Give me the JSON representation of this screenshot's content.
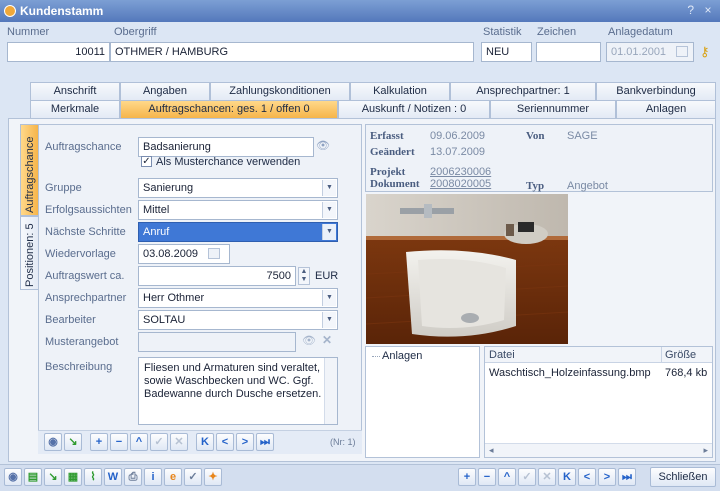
{
  "window": {
    "title": "Kundenstamm",
    "help": "?",
    "close": "×"
  },
  "header": {
    "nummer_label": "Nummer",
    "nummer_value": "10011",
    "obergriff_label": "Obergriff",
    "obergriff_value": "OTHMER / HAMBURG",
    "statistik_label": "Statistik",
    "statistik_value": "NEU",
    "zeichen_label": "Zeichen",
    "zeichen_value": "",
    "anlagedatum_label": "Anlagedatum",
    "anlagedatum_value": "01.01.2001"
  },
  "tabs_row1": [
    "Anschrift",
    "Angaben",
    "Zahlungskonditionen",
    "Kalkulation",
    "Ansprechpartner: 1",
    "Bankverbindung"
  ],
  "tabs_row2": [
    "Merkmale",
    "Auftragschancen: ges. 1 / offen 0",
    "Auskunft / Notizen : 0",
    "Seriennummer",
    "Anlagen"
  ],
  "side_tabs": [
    "Auftragschance",
    "Positionen: 5"
  ],
  "form": {
    "auftragschance_label": "Auftragschance",
    "auftragschance_value": "Badsanierung",
    "muster_checkbox_label": "Als Musterchance verwenden",
    "gruppe_label": "Gruppe",
    "gruppe_value": "Sanierung",
    "erfolg_label": "Erfolgsaussichten",
    "erfolg_value": "Mittel",
    "naechste_label": "Nächste Schritte",
    "naechste_value": "Anruf",
    "wiedervorlage_label": "Wiedervorlage",
    "wiedervorlage_value": "03.08.2009",
    "auftragswert_label": "Auftragswert ca.",
    "auftragswert_value": "7500",
    "currency": "EUR",
    "ansprechpartner_label": "Ansprechpartner",
    "ansprechpartner_value": "Herr Othmer",
    "bearbeiter_label": "Bearbeiter",
    "bearbeiter_value": "SOLTAU",
    "musterangebot_label": "Musterangebot",
    "musterangebot_value": "",
    "beschreibung_label": "Beschreibung",
    "beschreibung_value": "Fliesen und Armaturen sind veraltet, sowie Waschbecken und WC. Ggf. Badewanne durch Dusche ersetzen."
  },
  "info": {
    "erfasst_label": "Erfasst",
    "erfasst_value": "09.06.2009",
    "von_label": "Von",
    "von_value": "SAGE",
    "geaendert_label": "Geändert",
    "geaendert_value": "13.07.2009",
    "projekt_label": "Projekt",
    "projekt_value": "2006230006",
    "dokument_label": "Dokument",
    "dokument_value": "2008020005",
    "typ_label": "Typ",
    "typ_value": "Angebot"
  },
  "attachments": {
    "tree_root": "Anlagen",
    "col_datei": "Datei",
    "col_groesse": "Größe",
    "rows": [
      {
        "datei": "Waschtisch_Holzeinfassung.bmp",
        "groesse": "768,4 kb"
      }
    ]
  },
  "nav": {
    "record_counter": "(Nr: 1)"
  },
  "footer": {
    "close_label": "Schließen"
  }
}
